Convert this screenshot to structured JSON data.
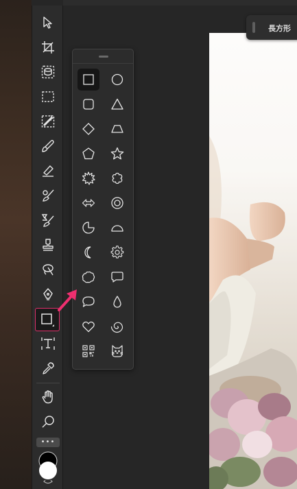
{
  "header": {
    "tool_label": "長方形"
  },
  "toolbar": {
    "selected_tool": "rectangle-tool",
    "more_label": "•••",
    "tools": [
      "move-tool",
      "crop-tool",
      "object-selection-tool",
      "rectangle-marquee-tool",
      "quick-action-tool",
      "brush-tool",
      "eraser-tool",
      "spot-healing-tool",
      "clone-tool",
      "stamp-tool",
      "lasso-tool",
      "pen-tool",
      "rectangle-tool",
      "type-tool",
      "eyedropper-tool",
      "hand-tool",
      "zoom-tool"
    ]
  },
  "shapes_flyout": {
    "selected": "square",
    "items": [
      "square",
      "circle",
      "rounded-square",
      "triangle",
      "diamond",
      "trapezoid",
      "pentagon",
      "star",
      "burst",
      "flower",
      "double-arrow",
      "ring",
      "pie",
      "half-circle",
      "crescent",
      "gear",
      "cloud",
      "speech-bubble",
      "round-speech-bubble",
      "drop",
      "heart",
      "spiral",
      "qr-code",
      "cat"
    ]
  },
  "colors": {
    "accent": "#e0306a",
    "icon": "#e6e6e6",
    "panel": "#2c2c2c",
    "foreground_color": "#000000",
    "background_color": "#ffffff"
  }
}
